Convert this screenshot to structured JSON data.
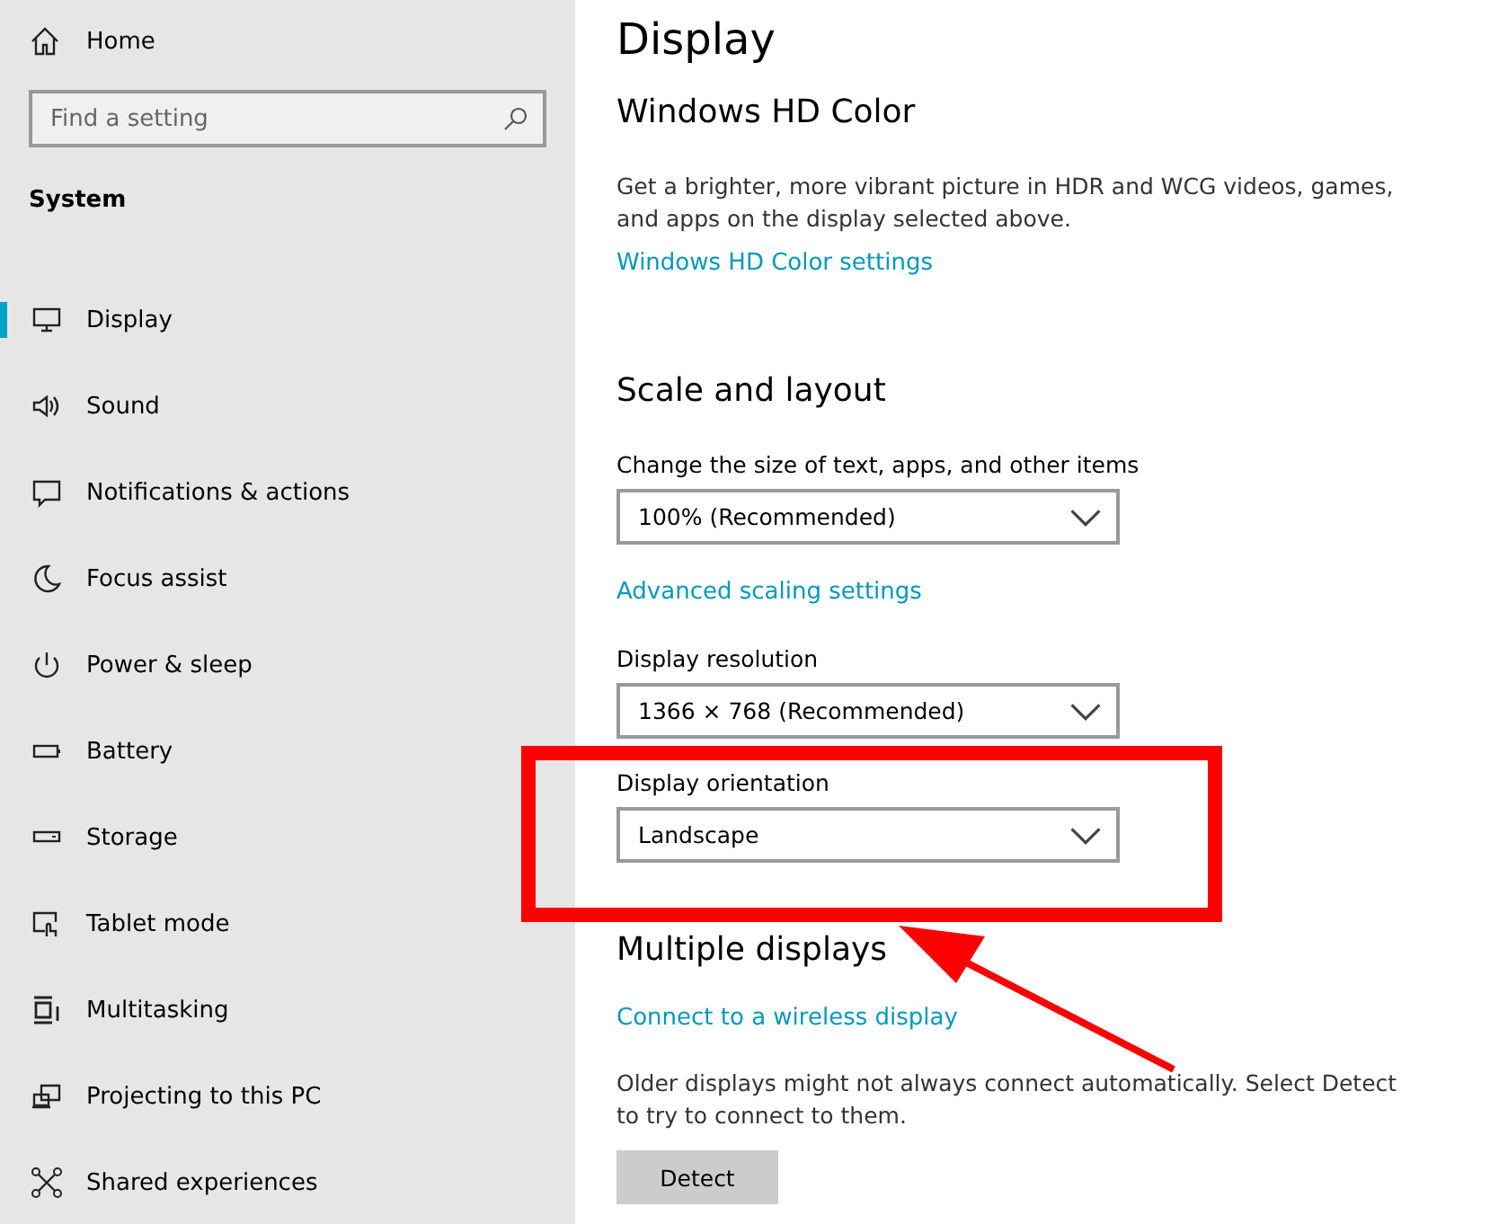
{
  "sidebar": {
    "home": "Home",
    "search": {
      "placeholder": "Find a setting"
    },
    "section": "System",
    "items": [
      {
        "label": "Display",
        "selected": true
      },
      {
        "label": "Sound",
        "selected": false
      },
      {
        "label": "Notifications & actions",
        "selected": false
      },
      {
        "label": "Focus assist",
        "selected": false
      },
      {
        "label": "Power & sleep",
        "selected": false
      },
      {
        "label": "Battery",
        "selected": false
      },
      {
        "label": "Storage",
        "selected": false
      },
      {
        "label": "Tablet mode",
        "selected": false
      },
      {
        "label": "Multitasking",
        "selected": false
      },
      {
        "label": "Projecting to this PC",
        "selected": false
      },
      {
        "label": "Shared experiences",
        "selected": false
      }
    ]
  },
  "main": {
    "title": "Display",
    "hd_color": {
      "heading": "Windows HD Color",
      "text": "Get a brighter, more vibrant picture in HDR and WCG videos, games, and apps on the display selected above.",
      "link": "Windows HD Color settings"
    },
    "scale_layout": {
      "heading": "Scale and layout",
      "scale_label": "Change the size of text, apps, and other items",
      "scale_value": "100% (Recommended)",
      "scale_link": "Advanced scaling settings",
      "resolution_label": "Display resolution",
      "resolution_value": "1366 × 768 (Recommended)",
      "orientation_label": "Display orientation",
      "orientation_value": "Landscape"
    },
    "multiple": {
      "heading": "Multiple displays",
      "link": "Connect to a wireless display",
      "text": "Older displays might not always connect automatically. Select Detect to try to connect to them.",
      "button": "Detect"
    }
  }
}
